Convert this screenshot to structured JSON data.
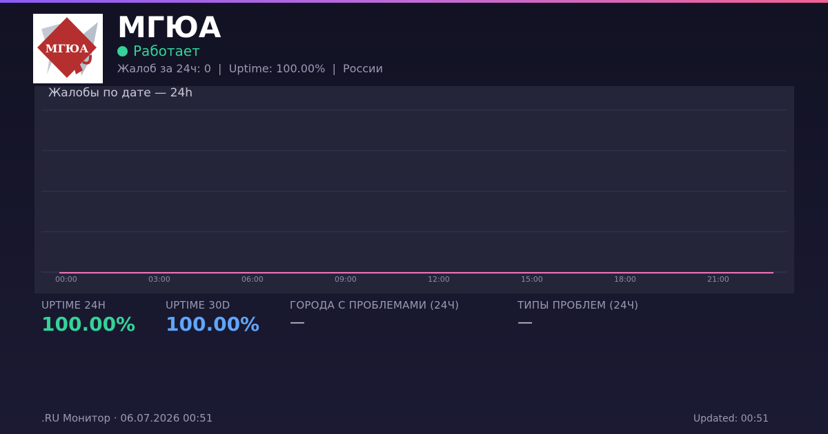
{
  "header": {
    "logo_text": "МГЮА",
    "title": "МГЮА",
    "status": "Работает",
    "meta": "Жалоб за 24ч: 0  |  Uptime: 100.00%  |  России"
  },
  "colors": {
    "accent_green": "#34d399",
    "accent_blue": "#60a5fa",
    "line_pink": "#f472b6",
    "logo_red": "#b52f2f"
  },
  "chart_data": {
    "type": "line",
    "title": "Жалобы по дате — 24h",
    "xlabel": "",
    "ylabel": "",
    "x": [
      "00:00",
      "01:00",
      "02:00",
      "03:00",
      "04:00",
      "05:00",
      "06:00",
      "07:00",
      "08:00",
      "09:00",
      "10:00",
      "11:00",
      "12:00",
      "13:00",
      "14:00",
      "15:00",
      "16:00",
      "17:00",
      "18:00",
      "19:00",
      "20:00",
      "21:00",
      "22:00",
      "23:00"
    ],
    "x_tick_labels": [
      "00:00",
      "03:00",
      "06:00",
      "09:00",
      "12:00",
      "15:00",
      "18:00",
      "21:00"
    ],
    "series": [
      {
        "values": [
          0,
          0,
          0,
          0,
          0,
          0,
          0,
          0,
          0,
          0,
          0,
          0,
          0,
          0,
          0,
          0,
          0,
          0,
          0,
          0,
          0,
          0,
          0,
          0
        ]
      }
    ],
    "ylim": [
      0,
      4
    ],
    "grid": true
  },
  "stats": [
    {
      "label": "UPTIME 24H",
      "value": "100.00%",
      "color": "#34d399"
    },
    {
      "label": "UPTIME 30D",
      "value": "100.00%",
      "color": "#60a5fa"
    },
    {
      "label": "ГОРОДА С ПРОБЛЕМАМИ (24Ч)",
      "value": "—"
    },
    {
      "label": "ТИПЫ ПРОБЛЕМ (24Ч)",
      "value": "—"
    }
  ],
  "footer": {
    "left": ".RU Монитор · 06.07.2026 00:51",
    "right": "Updated: 00:51"
  }
}
